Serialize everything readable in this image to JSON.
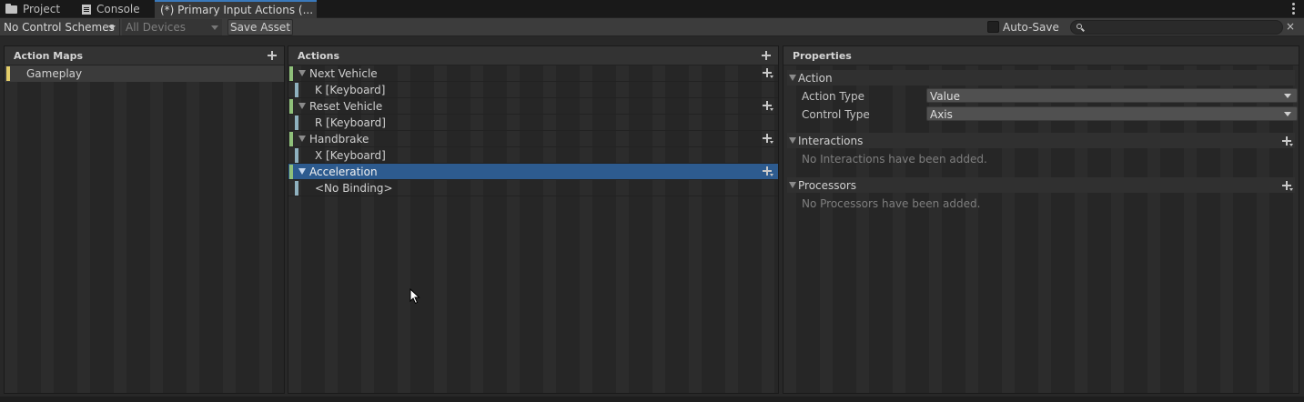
{
  "tabs": [
    {
      "label": "Project",
      "icon": "folder-icon"
    },
    {
      "label": "Console",
      "icon": "console-icon"
    },
    {
      "label": "(*) Primary Input Actions (...",
      "active": true
    }
  ],
  "toolbar": {
    "control_schemes": "No Control Schemes",
    "devices": "All Devices",
    "save_label": "Save Asset",
    "autosave_label": "Auto-Save",
    "autosave_checked": false,
    "search_value": "",
    "search_clear": "×"
  },
  "action_maps": {
    "title": "Action Maps",
    "items": [
      {
        "label": "Gameplay",
        "selected": true
      }
    ]
  },
  "actions": {
    "title": "Actions",
    "items": [
      {
        "label": "Next Vehicle",
        "binding": "K [Keyboard]"
      },
      {
        "label": "Reset Vehicle",
        "binding": "R [Keyboard]"
      },
      {
        "label": "Handbrake",
        "binding": "X [Keyboard]"
      },
      {
        "label": "Acceleration",
        "binding": "<No Binding>",
        "selected": true
      }
    ]
  },
  "properties": {
    "title": "Properties",
    "action_section": "Action",
    "action_type_label": "Action Type",
    "action_type_value": "Value",
    "control_type_label": "Control Type",
    "control_type_value": "Axis",
    "interactions_section": "Interactions",
    "interactions_empty": "No Interactions have been added.",
    "processors_section": "Processors",
    "processors_empty": "No Processors have been added."
  },
  "colors": {
    "map_accent": "#e3cd6a",
    "action_accent": "#8fc07a",
    "binding_accent": "#8fb1bf",
    "selection": "#2d5b8f"
  }
}
